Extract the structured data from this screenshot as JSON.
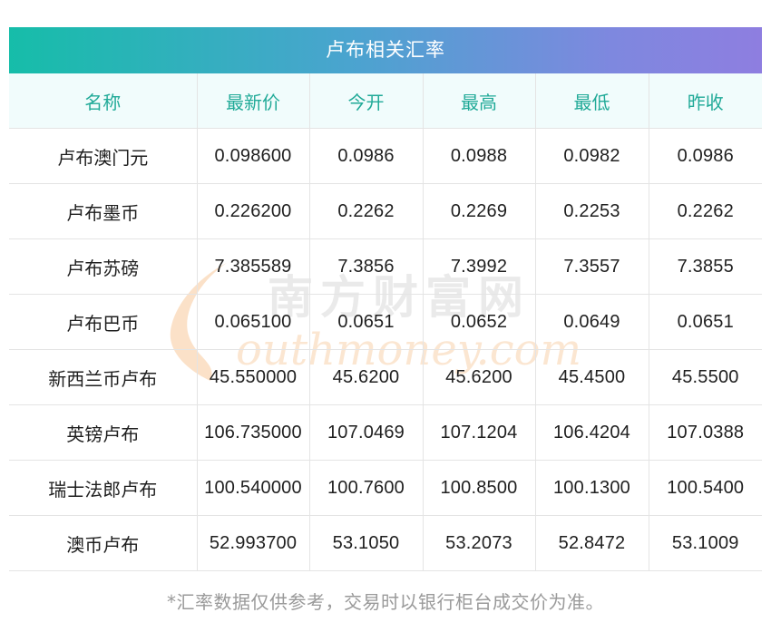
{
  "table": {
    "title": "卢布相关汇率",
    "headers": [
      "名称",
      "最新价",
      "今开",
      "最高",
      "最低",
      "昨收"
    ],
    "rows": [
      [
        "卢布澳门元",
        "0.098600",
        "0.0986",
        "0.0988",
        "0.0982",
        "0.0986"
      ],
      [
        "卢布墨币",
        "0.226200",
        "0.2262",
        "0.2269",
        "0.2253",
        "0.2262"
      ],
      [
        "卢布苏磅",
        "7.385589",
        "7.3856",
        "7.3992",
        "7.3557",
        "7.3855"
      ],
      [
        "卢布巴币",
        "0.065100",
        "0.0651",
        "0.0652",
        "0.0649",
        "0.0651"
      ],
      [
        "新西兰币卢布",
        "45.550000",
        "45.6200",
        "45.6200",
        "45.4500",
        "45.5500"
      ],
      [
        "英镑卢布",
        "106.735000",
        "107.0469",
        "107.1204",
        "106.4204",
        "107.0388"
      ],
      [
        "瑞士法郎卢布",
        "100.540000",
        "100.7600",
        "100.8500",
        "100.1300",
        "100.5400"
      ],
      [
        "澳币卢布",
        "52.993700",
        "53.1050",
        "53.2073",
        "52.8472",
        "53.1009"
      ]
    ]
  },
  "watermark": {
    "cn_text": "南方财富网",
    "en_text": "outhmoney.com",
    "color": "#f7c89b"
  },
  "footnote": "*汇率数据仅供参考，交易时以银行柜台成交价为准。",
  "colors": {
    "header_text": "#21aa98",
    "header_bg": "#f1fcfc",
    "title_gradient_start": "#16bda9",
    "title_gradient_end": "#8e7ee0"
  }
}
